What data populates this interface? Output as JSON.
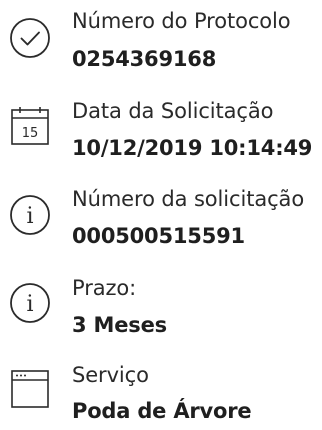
{
  "items": [
    {
      "icon": "check-circle-icon",
      "label": "Número do Protocolo",
      "value": "0254369168"
    },
    {
      "icon": "calendar-icon",
      "calendar_day": "15",
      "label": "Data da Solicitação",
      "value": "10/12/2019 10:14:49"
    },
    {
      "icon": "info-icon",
      "label": "Número da solicitação",
      "value": "000500515591"
    },
    {
      "icon": "info-icon",
      "label": "Prazo:",
      "value": "3 Meses"
    },
    {
      "icon": "window-icon",
      "label": "Serviço",
      "value": "Poda de Árvore"
    }
  ]
}
